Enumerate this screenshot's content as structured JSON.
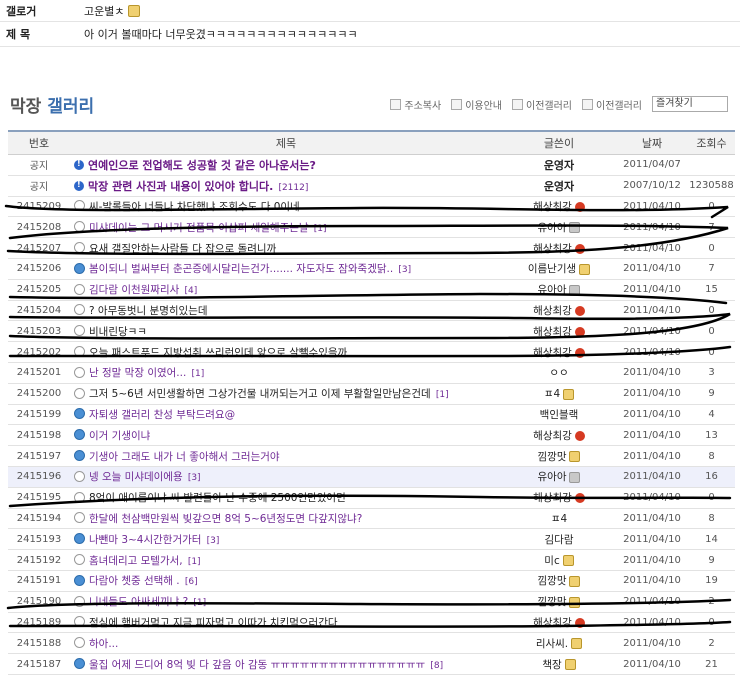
{
  "post": {
    "gallery_label": "갤로거",
    "gallery_value": "고운별ㅊ",
    "title_label": "제 목",
    "title_value": "아 이거 볼때마다 너무웃겼ㅋㅋㅋㅋㅋㅋㅋㅋㅋㅋㅋㅋㅋㅋㅋ"
  },
  "gallery": {
    "title_main": "막장",
    "title_accent": "갤러리",
    "tools": [
      "주소복사",
      "이용안내",
      "이전갤러리",
      "이전갤러리"
    ],
    "search_placeholder": "즐겨찾기"
  },
  "table": {
    "headers": {
      "no": "번호",
      "subject": "제목",
      "writer": "글쓴이",
      "date": "날짜",
      "views": "조회수"
    },
    "rows": [
      {
        "no": "공지",
        "icon": "info",
        "subject": "연예인으로 전업해도 성공할 것 같은 아나운서는?",
        "count": "",
        "writer": "운영자",
        "badge": "",
        "date": "2011/04/07",
        "views": "",
        "notice": true
      },
      {
        "no": "공지",
        "icon": "info",
        "subject": "막장 관련 사진과 내용이 있어야 합니다.",
        "count": "[2112]",
        "writer": "운영자",
        "badge": "",
        "date": "2007/10/12",
        "views": "1230588",
        "notice": true
      },
      {
        "no": "2415209",
        "icon": "txt",
        "subject": "씨-발롤들아 너들나 차단했냐 조회수도 다 0이네",
        "count": "",
        "writer": "해상최강",
        "badge": "red",
        "date": "2011/04/10",
        "views": "0"
      },
      {
        "no": "2415208",
        "icon": "txt",
        "subject": "미샤데이는 그 머시기 전품목 이삽퍼 세일해주는날",
        "count": "[1]",
        "writer": "유아아",
        "badge": "gray",
        "date": "2011/04/10",
        "views": "7",
        "visited": true
      },
      {
        "no": "2415207",
        "icon": "txt",
        "subject": "요새 갤질안하는사람들 다 잡으로 돌려니까",
        "count": "",
        "writer": "해상최강",
        "badge": "red",
        "date": "2011/04/10",
        "views": "0"
      },
      {
        "no": "2415206",
        "icon": "img",
        "subject": "봄이되니 벌써부터 춘곤증에시달리는건가....... 자도자도 잠와죽겠닭..",
        "count": "[3]",
        "writer": "이름난기생",
        "badge": "yellow",
        "date": "2011/04/10",
        "views": "7",
        "visited": true
      },
      {
        "no": "2415205",
        "icon": "txt",
        "subject": "김다람 이천원짜리사",
        "count": "[4]",
        "writer": "유아아",
        "badge": "gray",
        "date": "2011/04/10",
        "views": "15",
        "visited": true
      },
      {
        "no": "2415204",
        "icon": "txt",
        "subject": "? 아무동벗니 분명히있는데",
        "count": "",
        "writer": "해상최강",
        "badge": "red",
        "date": "2011/04/10",
        "views": "0"
      },
      {
        "no": "2415203",
        "icon": "txt",
        "subject": "비내린당ㅋㅋ",
        "count": "",
        "writer": "해상최강",
        "badge": "red",
        "date": "2011/04/10",
        "views": "0"
      },
      {
        "no": "2415202",
        "icon": "txt",
        "subject": "오늘 패스트푸드 지방섭취 쓰리런인데 앞으로 살뺄수있을까",
        "count": "",
        "writer": "해상최강",
        "badge": "red",
        "date": "2011/04/10",
        "views": "0"
      },
      {
        "no": "2415201",
        "icon": "txt",
        "subject": "난 정말 막장 이였어...",
        "count": "[1]",
        "writer": "ㅇㅇ",
        "badge": "",
        "date": "2011/04/10",
        "views": "3",
        "visited": true
      },
      {
        "no": "2415200",
        "icon": "txt",
        "subject": "그저 5~6년 서민생활하면 그상가건물 내꺼되는거고 이제 부활할일만남은건데",
        "count": "[1]",
        "writer": "ㅍ4",
        "badge": "yellow",
        "date": "2011/04/10",
        "views": "9"
      },
      {
        "no": "2415199",
        "icon": "img",
        "subject": "자퇴생 갤러리 찬성 부탁드려요@",
        "count": "",
        "writer": "백인블랙",
        "badge": "",
        "date": "2011/04/10",
        "views": "4",
        "visited": true
      },
      {
        "no": "2415198",
        "icon": "img",
        "subject": "이거 기생이냐",
        "count": "",
        "writer": "해상최강",
        "badge": "red",
        "date": "2011/04/10",
        "views": "13",
        "visited": true
      },
      {
        "no": "2415197",
        "icon": "img",
        "subject": "기생아 그래도 내가 너 좋아해서 그러는거야",
        "count": "",
        "writer": "낌깡맛",
        "badge": "yellow",
        "date": "2011/04/10",
        "views": "8",
        "visited": true
      },
      {
        "no": "2415196",
        "icon": "txt",
        "subject": "넹 오늘 미샤데이에용",
        "count": "[3]",
        "writer": "유아아",
        "badge": "gray",
        "date": "2011/04/10",
        "views": "16",
        "visited": true,
        "highlight": true
      },
      {
        "no": "2415195",
        "icon": "txt",
        "subject": "8억이 애이름이냐 씨-발련들아 난 수중에 2500언만있어면",
        "count": "",
        "writer": "해상최강",
        "badge": "red",
        "date": "2011/04/10",
        "views": "0"
      },
      {
        "no": "2415194",
        "icon": "txt",
        "subject": "한달에 천삼백만원씩 빚갚으면 8억 5~6년정도면 다갚지않냐?",
        "count": "",
        "writer": "ㅍ4",
        "badge": "",
        "date": "2011/04/10",
        "views": "8",
        "visited": true
      },
      {
        "no": "2415193",
        "icon": "img",
        "subject": "나뺀마 3~4시간한거가터",
        "count": "[3]",
        "writer": "김다람",
        "badge": "",
        "date": "2011/04/10",
        "views": "14",
        "visited": true
      },
      {
        "no": "2415192",
        "icon": "txt",
        "subject": "홈녀데리고 모텔가서,",
        "count": "[1]",
        "writer": "미c",
        "badge": "yellow",
        "date": "2011/04/10",
        "views": "9",
        "visited": true
      },
      {
        "no": "2415191",
        "icon": "img",
        "subject": "다람아 쳇중 선택해 .",
        "count": "[6]",
        "writer": "낌깡맛",
        "badge": "yellow",
        "date": "2011/04/10",
        "views": "19",
        "visited": true
      },
      {
        "no": "2415190",
        "icon": "txt",
        "subject": "니네들도 아싸세끼냐 ?",
        "count": "[1]",
        "writer": "낌깡맛",
        "badge": "yellow",
        "date": "2011/04/10",
        "views": "2",
        "visited": true
      },
      {
        "no": "2415189",
        "icon": "txt",
        "subject": "점심에 햄버거먹고 지금 피자먹고 이따가 치킨먹으러간다",
        "count": "",
        "writer": "해상최강",
        "badge": "red",
        "date": "2011/04/10",
        "views": "0"
      },
      {
        "no": "2415188",
        "icon": "txt",
        "subject": "하아...",
        "count": "",
        "writer": "리사씨.",
        "badge": "yellow",
        "date": "2011/04/10",
        "views": "2",
        "visited": true
      },
      {
        "no": "2415187",
        "icon": "img",
        "subject": "울집 어제 드디어 8억 빚 다 갚음 아 감동 ㅠㅠㅠㅠㅠㅠㅠㅠㅠㅠㅠㅠㅠㅠㅠㅠ",
        "count": "[8]",
        "writer": "책장",
        "badge": "yellow",
        "date": "2011/04/10",
        "views": "21",
        "visited": true
      }
    ]
  },
  "colors": {
    "accent": "#3c6fae",
    "notice": "#6a1a86",
    "visited": "#6f2a95"
  }
}
